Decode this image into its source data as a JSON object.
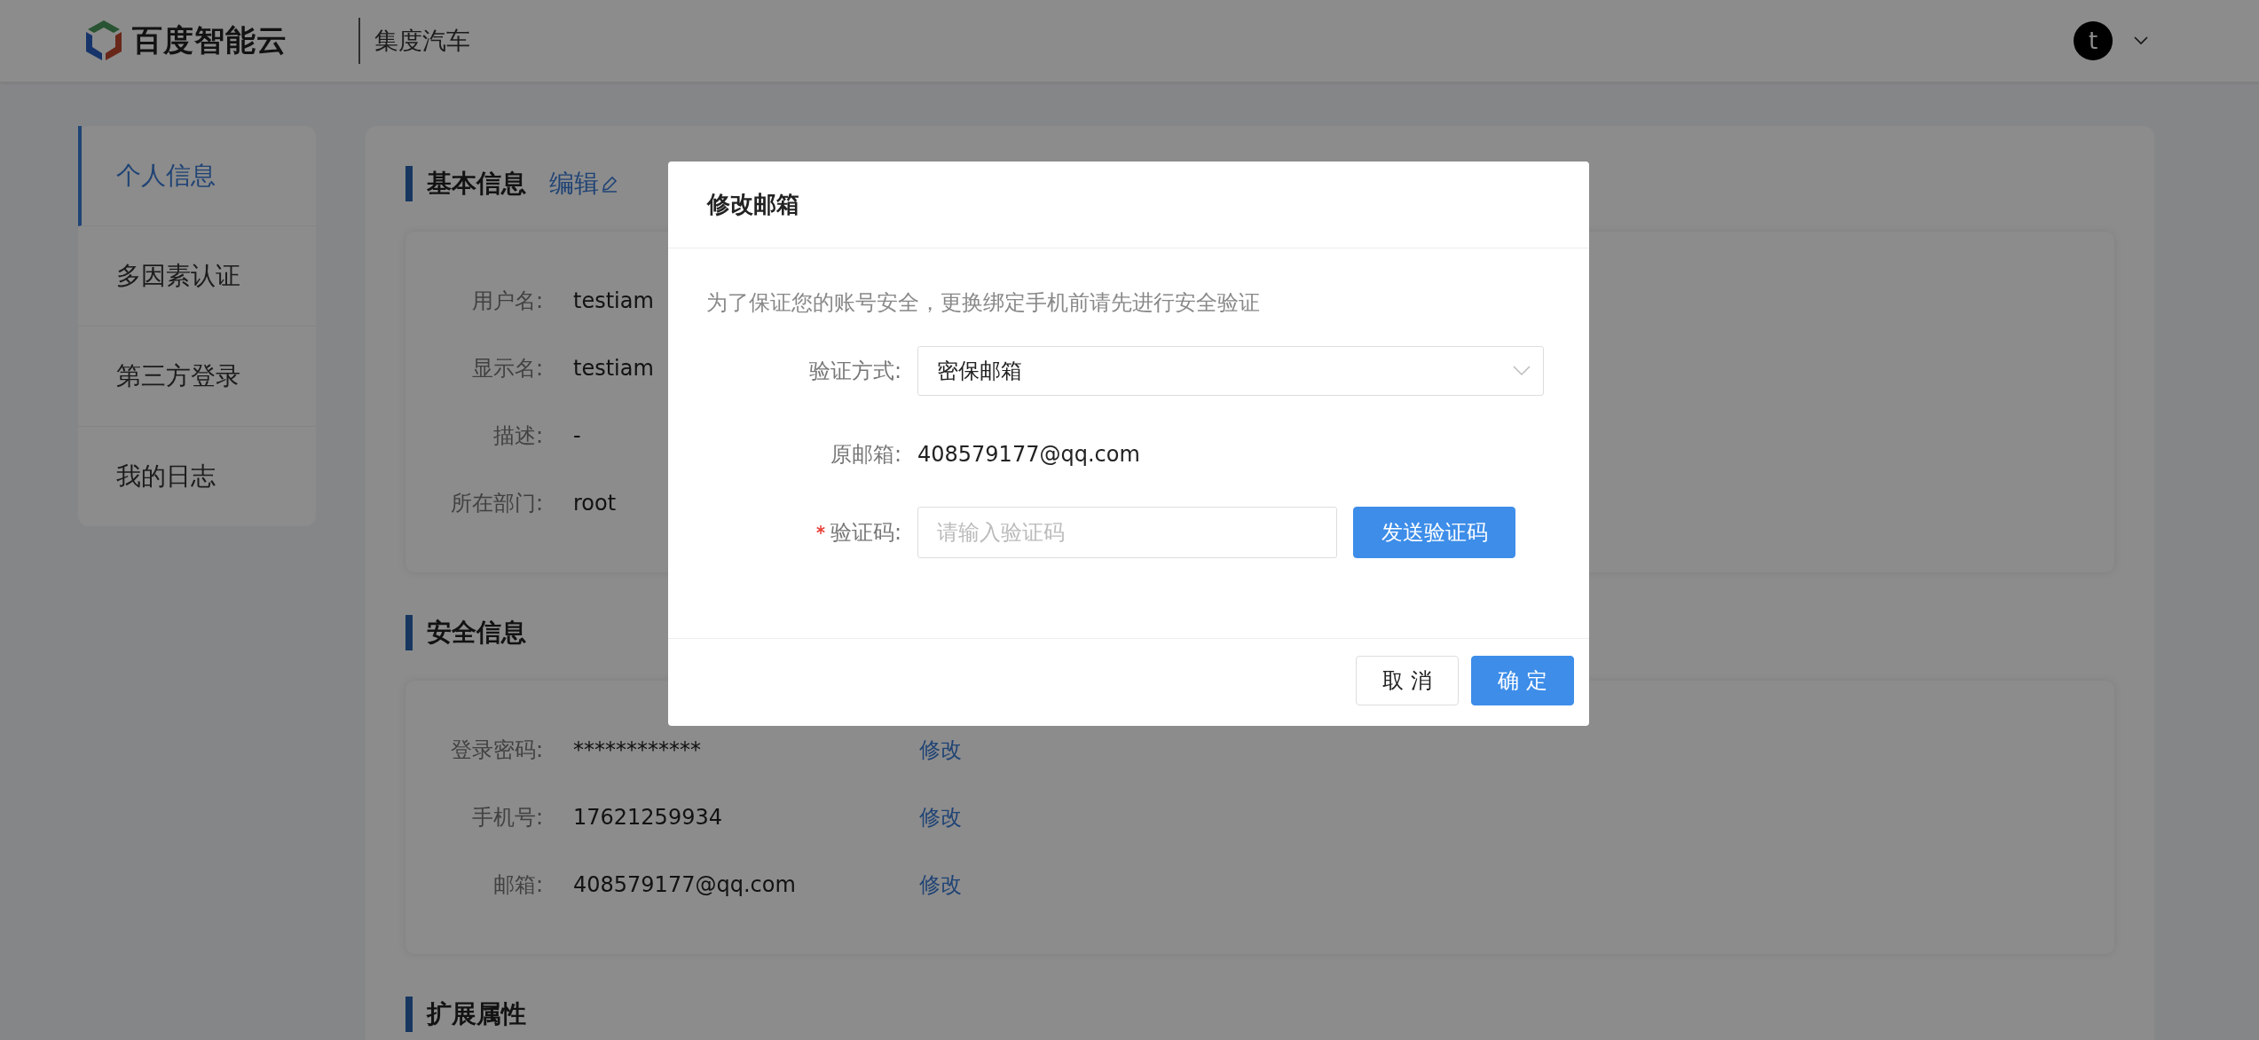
{
  "header": {
    "logo_text": "百度智能云",
    "product": "集度汽车",
    "avatar_letter": "t"
  },
  "sidebar": {
    "items": [
      {
        "label": "个人信息",
        "selected": true
      },
      {
        "label": "多因素认证",
        "selected": false
      },
      {
        "label": "第三方登录",
        "selected": false
      },
      {
        "label": "我的日志",
        "selected": false
      }
    ]
  },
  "sections": [
    {
      "title": "基本信息",
      "action": "编辑",
      "rows": [
        {
          "label": "用户名:",
          "value": "testiam"
        },
        {
          "label": "显示名:",
          "value": "testiam"
        },
        {
          "label": "描述:",
          "value": "-"
        },
        {
          "label": "所在部门:",
          "value": "root"
        }
      ]
    },
    {
      "title": "安全信息",
      "rows": [
        {
          "label": "登录密码:",
          "value": "************",
          "action": "修改"
        },
        {
          "label": "手机号:",
          "value": "17621259934",
          "action": "修改"
        },
        {
          "label": "邮箱:",
          "value": "408579177@qq.com",
          "action": "修改"
        }
      ]
    },
    {
      "title": "扩展属性"
    }
  ],
  "dialog": {
    "title": "修改邮箱",
    "notice": "为了保证您的账号安全，更换绑定手机前请先进行安全验证",
    "fields": [
      {
        "kind": "select",
        "label": "验证方式:",
        "value": "密保邮箱",
        "required": false
      },
      {
        "kind": "text",
        "label": "原邮箱:",
        "value": "408579177@qq.com",
        "required": false
      },
      {
        "kind": "code",
        "label": "验证码:",
        "placeholder": "请输入验证码",
        "button": "发送验证码",
        "required": true
      }
    ],
    "buttons": [
      {
        "label": "取 消",
        "kind": "default"
      },
      {
        "label": "确 定",
        "kind": "primary"
      }
    ]
  }
}
